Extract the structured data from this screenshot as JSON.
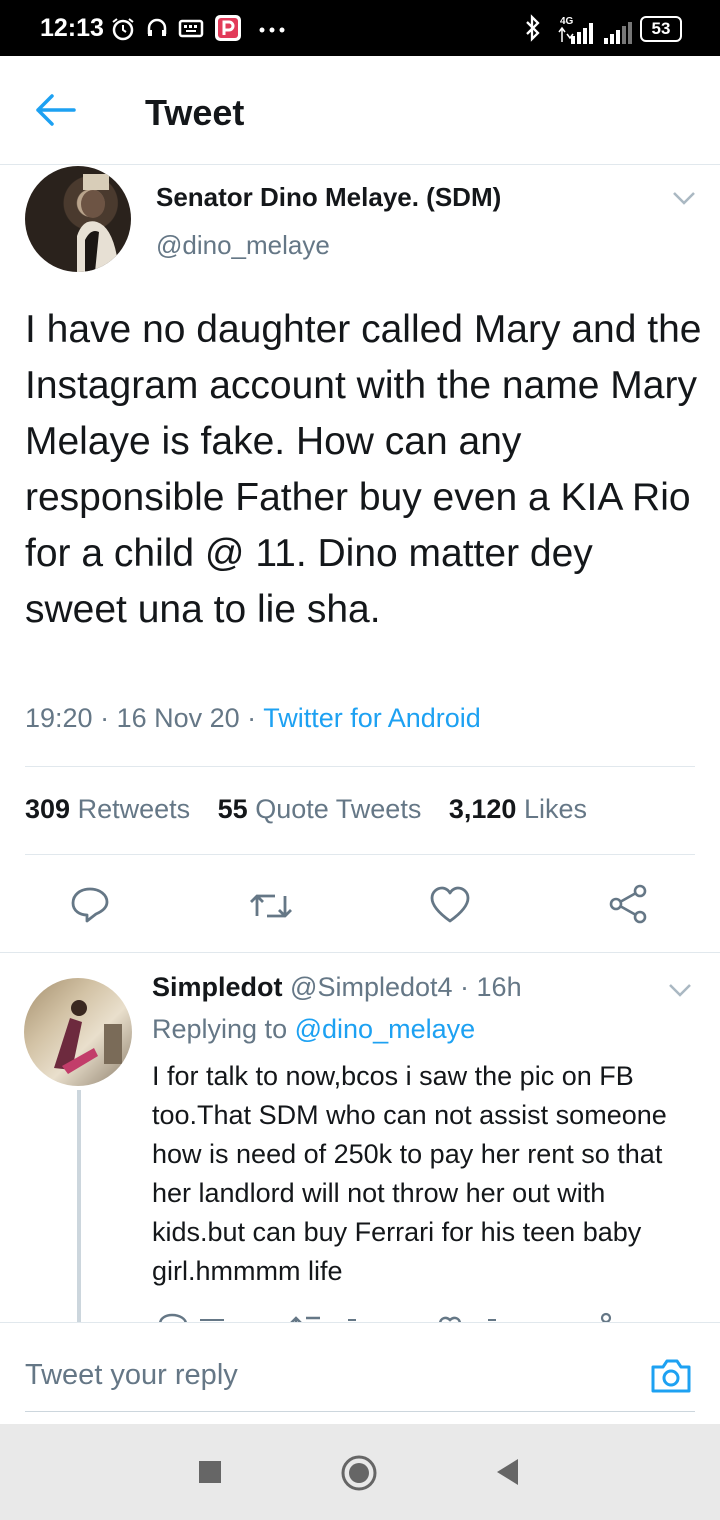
{
  "status_bar": {
    "time": "12:13",
    "network": "4G",
    "battery": "53"
  },
  "header": {
    "title": "Tweet"
  },
  "tweet": {
    "author_name": "Senator Dino Melaye. (SDM)",
    "author_handle": "@dino_melaye",
    "text": "I have no daughter called Mary and the Instagram account with the name Mary Melaye is fake. How can any responsible Father buy even a KIA Rio for a child @ 11. Dino matter dey sweet una to lie sha.",
    "time": "19:20",
    "date": "16 Nov 20",
    "source": "Twitter for Android",
    "stats": {
      "retweets": "309",
      "retweets_label": "Retweets",
      "quotes": "55",
      "quotes_label": "Quote Tweets",
      "likes": "3,120",
      "likes_label": "Likes"
    }
  },
  "reply": {
    "author_name": "Simpledot",
    "author_handle": "@Simpledot4",
    "time": "16h",
    "replying_to_label": "Replying to",
    "replying_to_handle": "@dino_melaye",
    "text": "I for talk to now,bcos i saw the pic on FB too.That SDM who can not assist someone how is need of 250k to pay her rent so that her landlord will not throw her out with kids.but can buy Ferrari for his teen baby girl.hmmmm life"
  },
  "composer": {
    "placeholder": "Tweet your reply"
  },
  "colors": {
    "accent": "#1da1f2",
    "secondary_text": "#657786",
    "primary_text": "#14171a"
  }
}
